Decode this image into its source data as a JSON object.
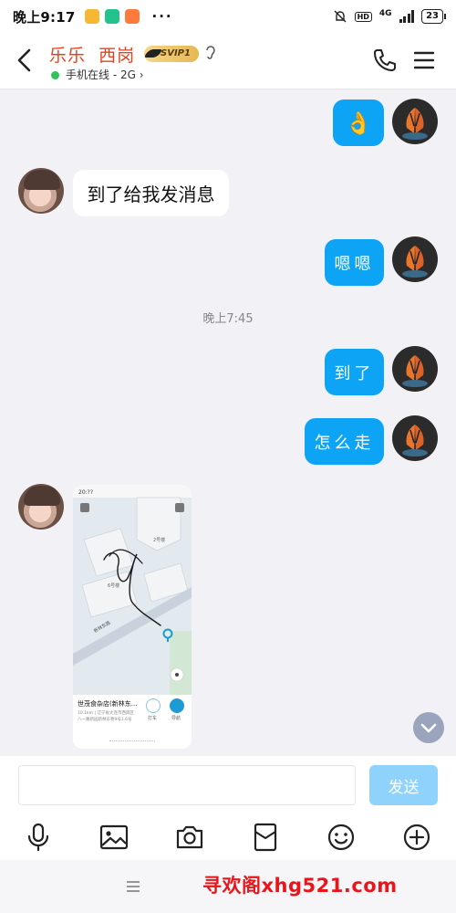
{
  "status_bar": {
    "time": "晚上9:17",
    "signal_label": "4G",
    "hd": "HD",
    "battery": "23",
    "more": "···"
  },
  "header": {
    "contact_name": "乐乐  西岗",
    "vip_label": "SVIP1",
    "online_status": "手机在线 - 2G",
    "online_chevron": "›"
  },
  "messages": [
    {
      "side": "out",
      "text": "👌"
    },
    {
      "side": "in",
      "text": "到了给我发消息"
    },
    {
      "side": "out",
      "text": "嗯嗯"
    },
    {
      "side": "out",
      "text": "到了"
    },
    {
      "side": "out",
      "text": "怎么走"
    },
    {
      "side": "in",
      "type": "image"
    }
  ],
  "timestamp": "晚上7:45",
  "map_image": {
    "status_time": "20:??",
    "place_name": "世茂食杂店(新林东...",
    "place_detail": "10.1km | 辽宁省大连市西岗区",
    "place_detail2": "八一路新园新林东巷9号1.6号",
    "label_building1": "2号楼",
    "label_building2": "6号楼",
    "label_street": "新林东路",
    "btn_taxi": "打车",
    "btn_nav": "导航"
  },
  "input": {
    "placeholder": "",
    "value": ""
  },
  "send_label": "发送",
  "toolbar_icons": [
    "microphone-icon",
    "image-icon",
    "camera-icon",
    "red-packet-icon",
    "emoji-icon",
    "plus-icon"
  ],
  "watermark": "寻欢阁xhg521.com",
  "colors": {
    "accent": "#0ea4f5",
    "name": "#e8401c",
    "online": "#30c35a",
    "watermark": "#e8151b"
  }
}
